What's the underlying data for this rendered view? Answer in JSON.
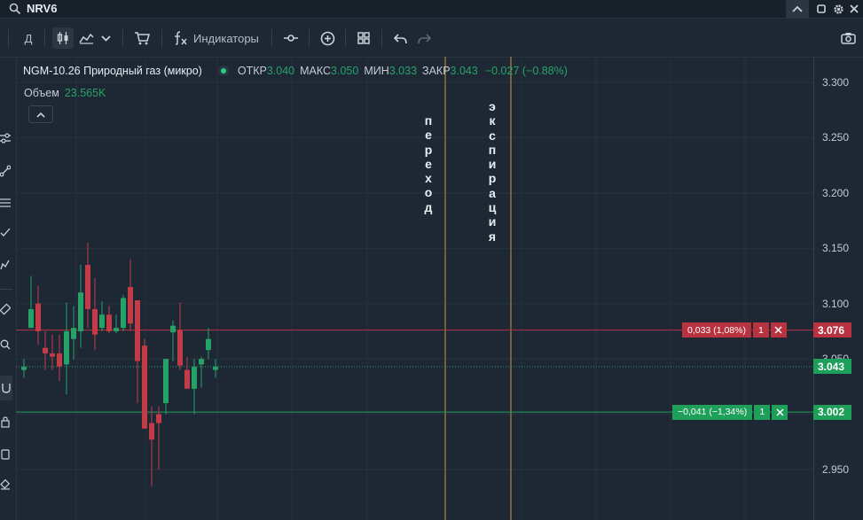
{
  "search": {
    "value": "NRV6"
  },
  "toolbar": {
    "period_label": "Д",
    "indicators_label": "Индикаторы"
  },
  "legend": {
    "title": "NGM-10.26 Природный газ (микро)",
    "open_label": "ОТКР",
    "open": "3.040",
    "high_label": "МАКС",
    "high": "3.050",
    "low_label": "МИН",
    "low": "3.033",
    "close_label": "ЗАКР",
    "close": "3.043",
    "change": "−0.027 (−0.88%)"
  },
  "volume": {
    "label": "Объем",
    "value": "23.565K"
  },
  "annotations": {
    "transition": "переход",
    "expiration": "экспирация"
  },
  "price_axis": {
    "ticks": [
      "3.300",
      "3.250",
      "3.200",
      "3.150",
      "3.100",
      "3.050",
      "3.000",
      "2.950"
    ]
  },
  "orders": {
    "sell": {
      "label": "0,033 (1,08%)",
      "qty": "1",
      "price": "3.076",
      "color": "#b8323f"
    },
    "buy": {
      "label": "−0,041 (−1,34%)",
      "qty": "1",
      "price": "3.002",
      "color": "#1e9f5a"
    }
  },
  "current_price": {
    "value": "3.043",
    "color": "#1e9f5a"
  },
  "colors": {
    "up": "#26a269",
    "down": "#c23b47",
    "background": "#1e2834",
    "vline": "#c49a3a"
  },
  "chart_data": {
    "type": "candlestick",
    "ylim": [
      2.925,
      3.325
    ],
    "candles": [
      {
        "o": 3.04,
        "h": 3.05,
        "l": 3.033,
        "c": 3.043
      },
      {
        "o": 3.078,
        "h": 3.125,
        "l": 3.078,
        "c": 3.095
      },
      {
        "o": 3.1,
        "h": 3.116,
        "l": 3.063,
        "c": 3.075
      },
      {
        "o": 3.06,
        "h": 3.075,
        "l": 3.04,
        "c": 3.055
      },
      {
        "o": 3.055,
        "h": 3.072,
        "l": 3.04,
        "c": 3.052
      },
      {
        "o": 3.055,
        "h": 3.072,
        "l": 3.03,
        "c": 3.043
      },
      {
        "o": 3.045,
        "h": 3.101,
        "l": 3.018,
        "c": 3.075
      },
      {
        "o": 3.068,
        "h": 3.098,
        "l": 3.049,
        "c": 3.078
      },
      {
        "o": 3.075,
        "h": 3.135,
        "l": 3.06,
        "c": 3.11
      },
      {
        "o": 3.135,
        "h": 3.155,
        "l": 3.078,
        "c": 3.095
      },
      {
        "o": 3.095,
        "h": 3.123,
        "l": 3.058,
        "c": 3.072
      },
      {
        "o": 3.078,
        "h": 3.102,
        "l": 3.075,
        "c": 3.09
      },
      {
        "o": 3.09,
        "h": 3.098,
        "l": 3.073,
        "c": 3.075
      },
      {
        "o": 3.075,
        "h": 3.09,
        "l": 3.073,
        "c": 3.078
      },
      {
        "o": 3.078,
        "h": 3.108,
        "l": 3.075,
        "c": 3.105
      },
      {
        "o": 3.115,
        "h": 3.14,
        "l": 3.075,
        "c": 3.082
      },
      {
        "o": 3.103,
        "h": 3.102,
        "l": 3.01,
        "c": 3.048
      },
      {
        "o": 3.062,
        "h": 3.068,
        "l": 3.01,
        "c": 2.987
      },
      {
        "o": 2.992,
        "h": 3.007,
        "l": 2.935,
        "c": 2.977
      },
      {
        "o": 3.0,
        "h": 3.007,
        "l": 2.95,
        "c": 2.992
      },
      {
        "o": 3.01,
        "h": 3.048,
        "l": 3.0,
        "c": 3.05
      },
      {
        "o": 3.074,
        "h": 3.085,
        "l": 3.048,
        "c": 3.08
      },
      {
        "o": 3.076,
        "h": 3.101,
        "l": 3.04,
        "c": 3.044
      },
      {
        "o": 3.04,
        "h": 3.052,
        "l": 3.025,
        "c": 3.023
      },
      {
        "o": 3.023,
        "h": 3.05,
        "l": 3.0,
        "c": 3.043
      },
      {
        "o": 3.045,
        "h": 3.052,
        "l": 3.024,
        "c": 3.05
      },
      {
        "o": 3.058,
        "h": 3.078,
        "l": 3.05,
        "c": 3.068
      },
      {
        "o": 3.04,
        "h": 3.05,
        "l": 3.033,
        "c": 3.043
      }
    ]
  }
}
